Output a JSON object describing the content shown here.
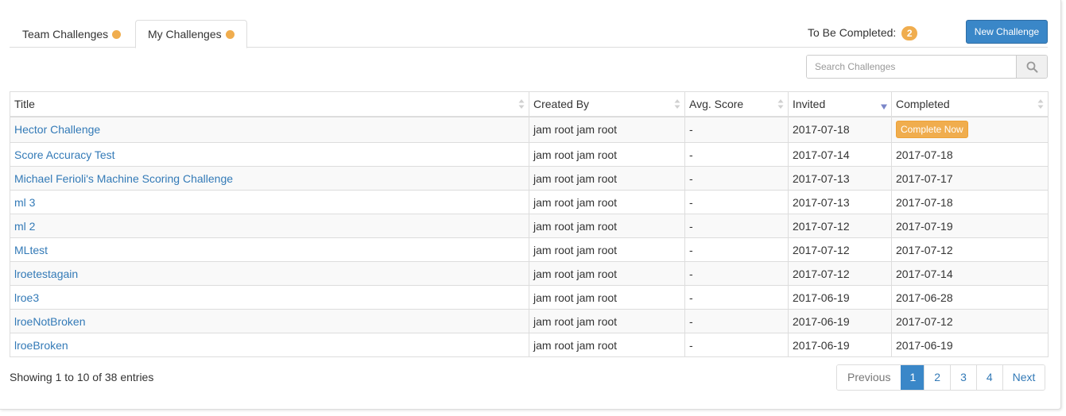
{
  "tabs": [
    {
      "label": "Team Challenges",
      "has_dot": true
    },
    {
      "label": "My Challenges",
      "has_dot": true,
      "active": true
    }
  ],
  "to_be_completed": {
    "label": "To Be Completed:",
    "count": "2"
  },
  "new_challenge_label": "New Challenge",
  "search": {
    "placeholder": "Search Challenges",
    "icon": "search-icon"
  },
  "table": {
    "columns": [
      "Title",
      "Created By",
      "Avg. Score",
      "Invited",
      "Completed"
    ],
    "sorted_column": "Invited",
    "rows": [
      {
        "title": "Hector Challenge",
        "created_by": "jam root jam root",
        "avg_score": "-",
        "invited": "2017-07-18",
        "completed": "Complete Now"
      },
      {
        "title": "Score Accuracy Test",
        "created_by": "jam root jam root",
        "avg_score": "-",
        "invited": "2017-07-14",
        "completed": "2017-07-18"
      },
      {
        "title": "Michael Ferioli's Machine Scoring Challenge",
        "created_by": "jam root jam root",
        "avg_score": "-",
        "invited": "2017-07-13",
        "completed": "2017-07-17"
      },
      {
        "title": "ml 3",
        "created_by": "jam root jam root",
        "avg_score": "-",
        "invited": "2017-07-13",
        "completed": "2017-07-18"
      },
      {
        "title": "ml 2",
        "created_by": "jam root jam root",
        "avg_score": "-",
        "invited": "2017-07-12",
        "completed": "2017-07-19"
      },
      {
        "title": "MLtest",
        "created_by": "jam root jam root",
        "avg_score": "-",
        "invited": "2017-07-12",
        "completed": "2017-07-12"
      },
      {
        "title": "lroetestagain",
        "created_by": "jam root jam root",
        "avg_score": "-",
        "invited": "2017-07-12",
        "completed": "2017-07-14"
      },
      {
        "title": "lroe3",
        "created_by": "jam root jam root",
        "avg_score": "-",
        "invited": "2017-06-19",
        "completed": "2017-06-28"
      },
      {
        "title": "lroeNotBroken",
        "created_by": "jam root jam root",
        "avg_score": "-",
        "invited": "2017-06-19",
        "completed": "2017-07-12"
      },
      {
        "title": "lroeBroken",
        "created_by": "jam root jam root",
        "avg_score": "-",
        "invited": "2017-06-19",
        "completed": "2017-06-19"
      }
    ]
  },
  "info_text": "Showing 1 to 10 of 38 entries",
  "pagination": {
    "previous": "Previous",
    "pages": [
      "1",
      "2",
      "3",
      "4"
    ],
    "current": "1",
    "next": "Next"
  },
  "colors": {
    "accent": "#3a87c8",
    "warning": "#f0ad4e",
    "link": "#337ab7"
  }
}
